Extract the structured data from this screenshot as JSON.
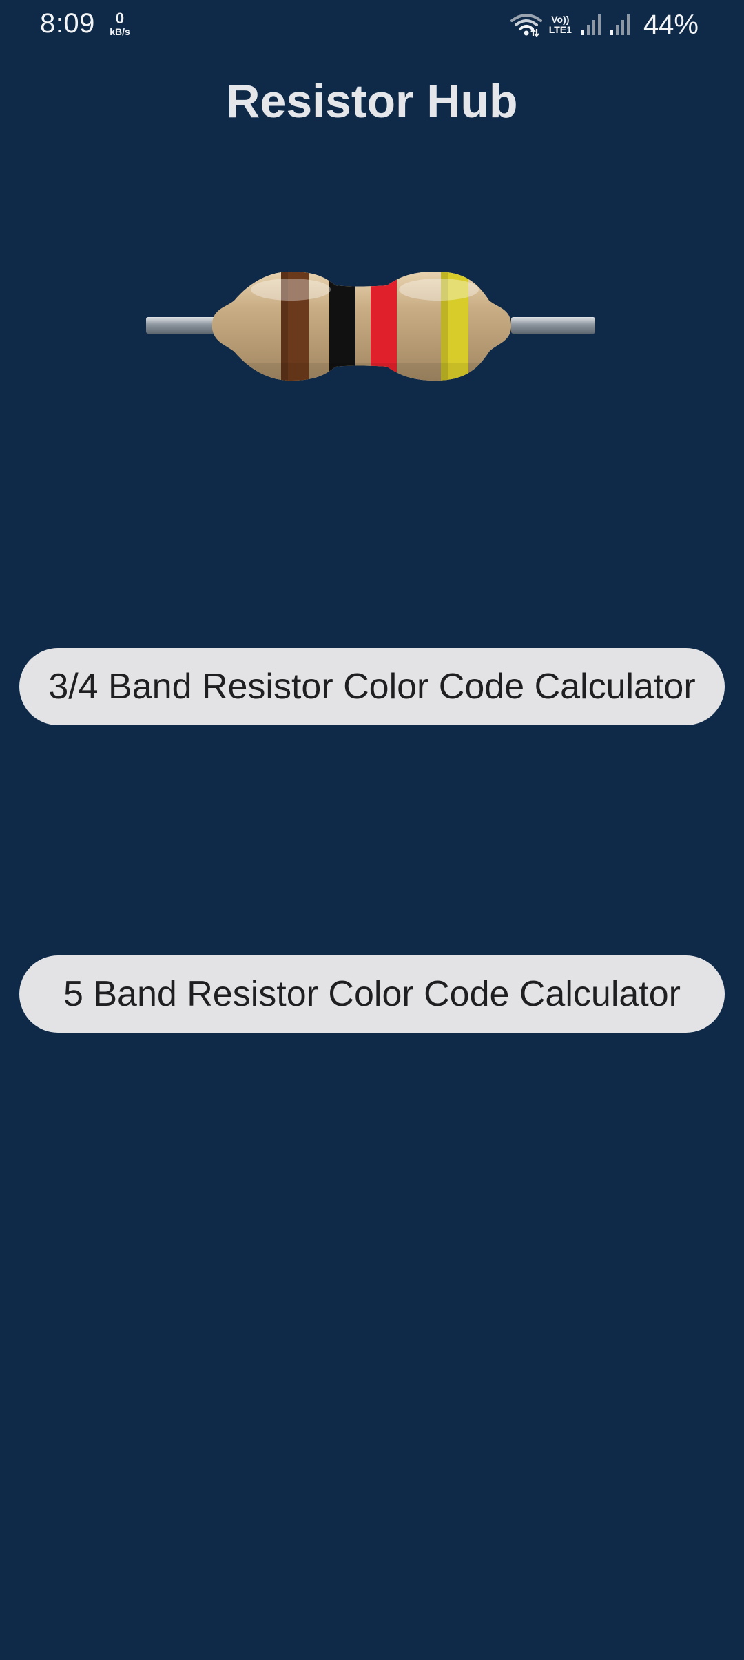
{
  "status_bar": {
    "time": "8:09",
    "net_speed_value": "0",
    "net_speed_unit": "kB/s",
    "volte_top": "Vo))",
    "volte_bottom": "LTE1",
    "battery": "44%",
    "icons": [
      "wifi-icon",
      "signal-icon",
      "signal-icon"
    ]
  },
  "header": {
    "title": "Resistor Hub"
  },
  "illustration": {
    "name": "resistor-illustration",
    "band_colors": [
      "#6b3a1c",
      "#111111",
      "#e0202a",
      "#d8cc2a"
    ],
    "body_color": "#c9ad84",
    "lead_color": "#9aa2ab"
  },
  "buttons": {
    "band_34_label": "3/4 Band Resistor Color Code Calculator",
    "band_5_label": "5 Band Resistor Color Code Calculator"
  },
  "colors": {
    "background": "#0f2a48",
    "button_bg": "#e3e3e5",
    "button_text": "#1f1f22",
    "title_text": "#e4e6ea"
  }
}
